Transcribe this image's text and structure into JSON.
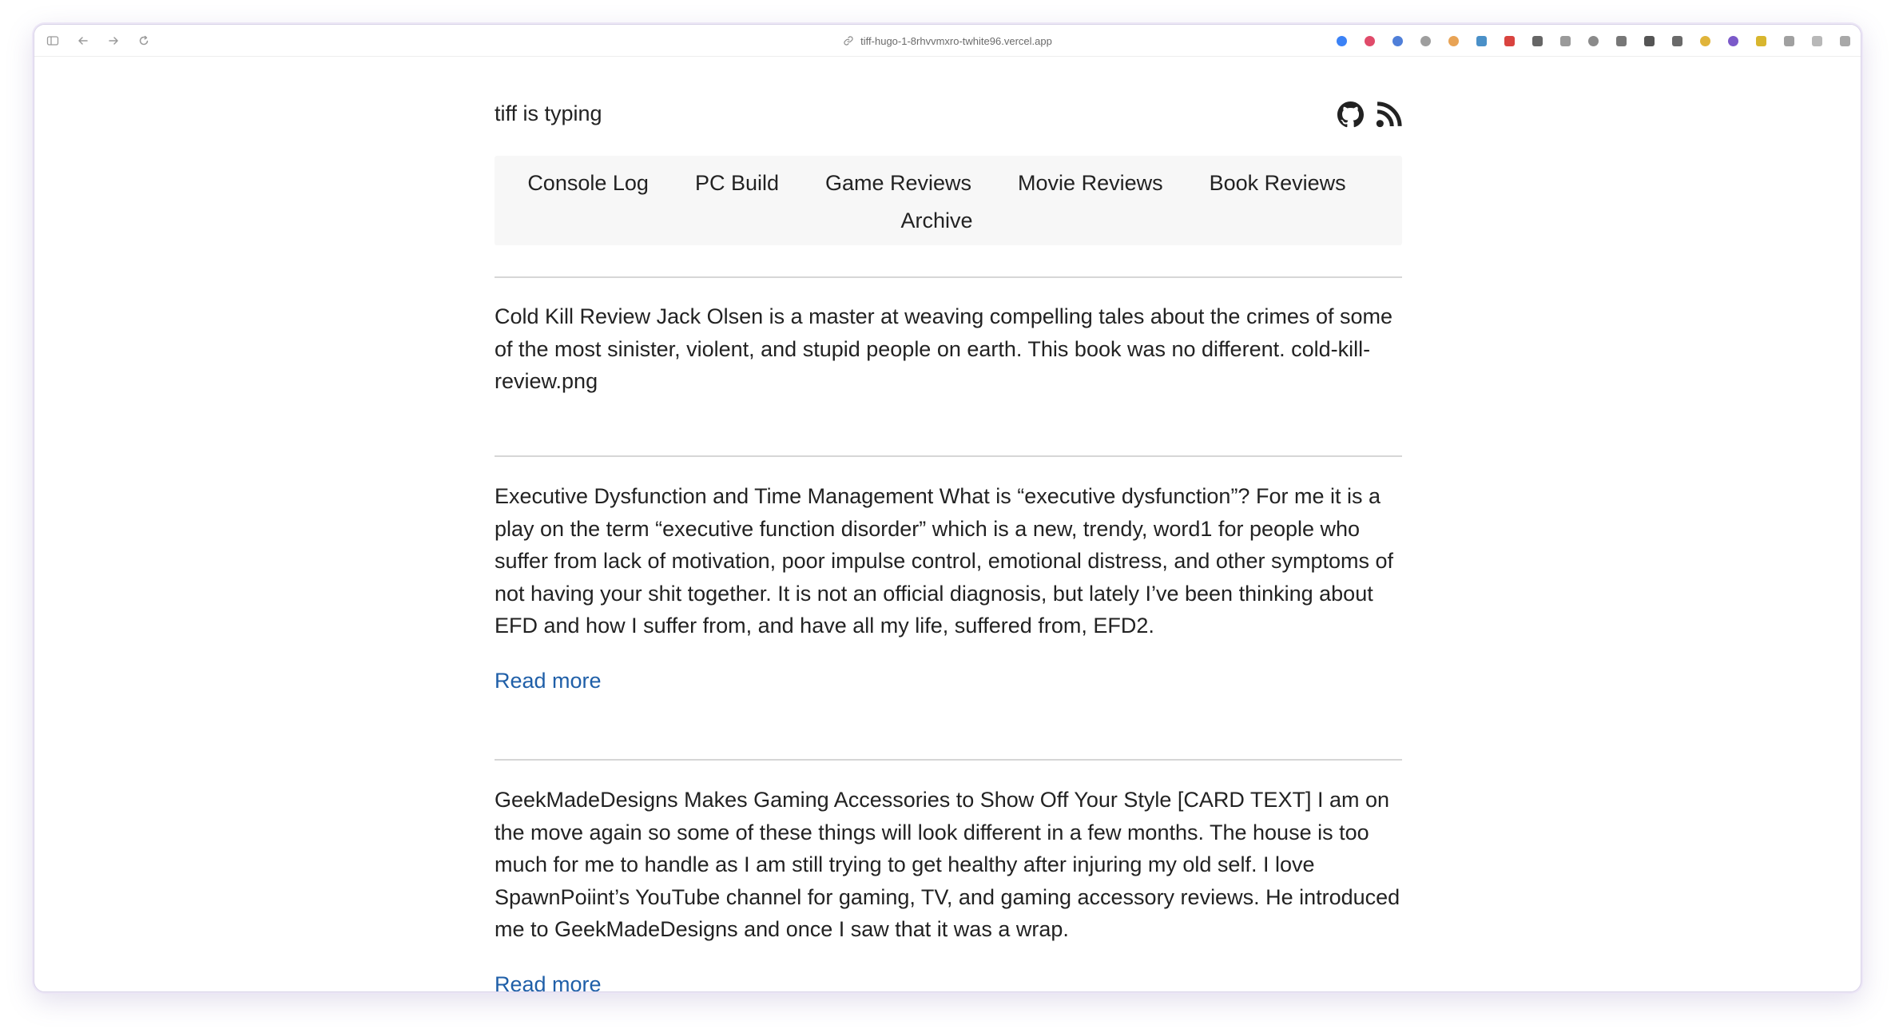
{
  "browser": {
    "url": "tiff-hugo-1-8rhvvmxro-twhite96.vercel.app",
    "extensions": [
      {
        "name": "globe-ext-icon",
        "color": "#3b82f6",
        "shape": "round"
      },
      {
        "name": "play-ext-icon",
        "color": "#e04b6a",
        "shape": "round"
      },
      {
        "name": "search-ext-icon",
        "color": "#4f7fd9",
        "shape": "round"
      },
      {
        "name": "power-ext-icon",
        "color": "#9e9e9e",
        "shape": "round"
      },
      {
        "name": "cookie-ext-icon",
        "color": "#e8a355",
        "shape": "round"
      },
      {
        "name": "table-ext-icon",
        "color": "#4a90c8",
        "shape": "square"
      },
      {
        "name": "shield-ext-icon",
        "color": "#d9433f",
        "shape": "square"
      },
      {
        "name": "keyboard-ext-icon",
        "color": "#666666",
        "shape": "square"
      },
      {
        "name": "image-ext-icon",
        "color": "#9a9a9a",
        "shape": "square"
      },
      {
        "name": "fan-ext-icon",
        "color": "#8a8a8a",
        "shape": "round"
      },
      {
        "name": "box-ext-icon",
        "color": "#777777",
        "shape": "square"
      },
      {
        "name": "notion-ext-icon",
        "color": "#555555",
        "shape": "square"
      },
      {
        "name": "pen-ext-icon",
        "color": "#6a6a6a",
        "shape": "square"
      },
      {
        "name": "ring-ext-icon",
        "color": "#e0b43a",
        "shape": "round"
      },
      {
        "name": "hex-ext-icon",
        "color": "#7b59c9",
        "shape": "round"
      },
      {
        "name": "r-ext-icon",
        "color": "#d8b62e",
        "shape": "square"
      },
      {
        "name": "card-ext-icon",
        "color": "#a0a0a0",
        "shape": "square"
      },
      {
        "name": "doc-ext-icon",
        "color": "#b8b8b8",
        "shape": "square"
      },
      {
        "name": "sidebar-right-icon",
        "color": "#a8a8a8",
        "shape": "square"
      }
    ]
  },
  "site": {
    "title": "tiff is typing",
    "icons": [
      "github-icon",
      "rss-icon"
    ]
  },
  "nav": {
    "items": [
      "Console Log",
      "PC Build",
      "Game Reviews",
      "Movie Reviews",
      "Book Reviews",
      "Archive"
    ]
  },
  "posts": [
    {
      "text": "Cold Kill Review Jack Olsen is a master at weaving compelling tales about the crimes of some of the most sinister, violent, and stupid people on earth. This book was no different. cold-kill-review.png",
      "read_more": ""
    },
    {
      "text": "Executive Dysfunction and Time Management What is “executive dysfunction”? For me it is a play on the term “executive function disorder” which is a new, trendy, word1 for people who suffer from lack of motivation, poor impulse control, emotional distress, and other symptoms of not having your shit together. It is not an official diagnosis, but lately I’ve been thinking about EFD and how I suffer from, and have all my life, suffered from, EFD2.",
      "read_more": "Read more"
    },
    {
      "text": "GeekMadeDesigns Makes Gaming Accessories to Show Off Your Style [CARD TEXT] I am on the move again so some of these things will look different in a few months. The house is too much for me to handle as I am still trying to get healthy after injuring my old self. I love SpawnPoiint’s YouTube channel for gaming, TV, and gaming accessory reviews. He introduced me to GeekMadeDesigns and once I saw that it was a wrap.",
      "read_more": "Read more"
    }
  ]
}
